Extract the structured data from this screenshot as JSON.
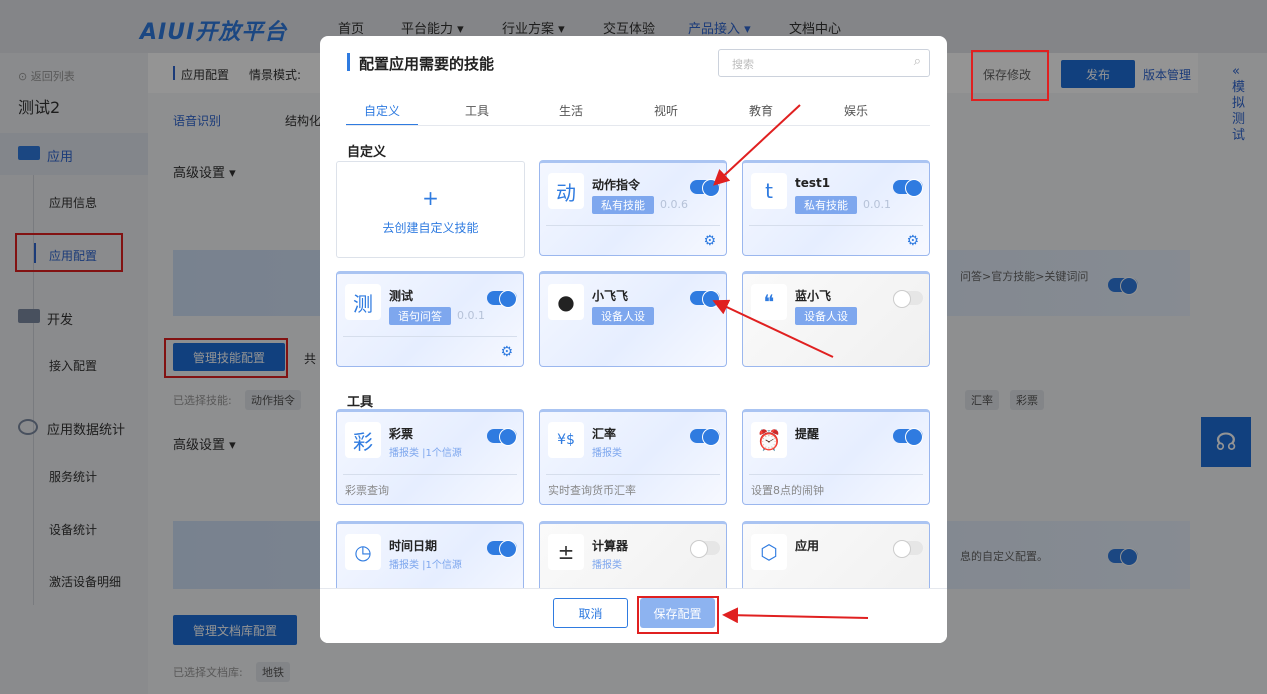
{
  "nav": {
    "logo_a": "AIUI",
    "logo_b": "开放平台",
    "items": [
      "首页",
      "平台能力 ▾",
      "行业方案 ▾",
      "交互体验",
      "产品接入 ▾",
      "文档中心"
    ]
  },
  "sidebar": {
    "back": "⊙ 返回列表",
    "app_name": "测试2",
    "section_app": "应用",
    "app_info": "应用信息",
    "app_config": "应用配置",
    "section_dev": "开发",
    "access_config": "接入配置",
    "section_stats": "应用数据统计",
    "service_stats": "服务统计",
    "device_stats": "设备统计",
    "activation_detail": "激活设备明细"
  },
  "main": {
    "breadcrumb": "应用配置",
    "scene_label": "情景模式:",
    "tab_asr": "语音识别",
    "tab_struct": "结构化",
    "adv1": "高级设置 ▾",
    "adv2": "高级设置 ▾",
    "manage_skill": "管理技能配置",
    "shared": "共",
    "selected_skills_label": "已选择技能:",
    "selected_skill_first": "动作指令",
    "selected_skill_r1": "汇率",
    "selected_skill_r2": "彩票",
    "banner1_text": "问答>官方技能>关键词问",
    "banner2_text": "息的自定义配置。",
    "manage_doc": "管理文档库配置",
    "selected_doc_label": "已选择文档库:",
    "selected_doc": "地铁",
    "save_changes": "保存修改",
    "publish": "发布",
    "version": "版本管理",
    "sim_test": "« 模 拟 测 试"
  },
  "modal": {
    "title": "配置应用需要的技能",
    "search_placeholder": "搜索",
    "tabs": [
      "自定义",
      "工具",
      "生活",
      "视听",
      "教育",
      "娱乐"
    ],
    "section_custom": "自定义",
    "create_plus": "+",
    "create_label": "去创建自定义技能",
    "section_tools": "工具",
    "cancel": "取消",
    "save": "保存配置",
    "custom_cards": [
      {
        "icon": "动",
        "name": "动作指令",
        "tag": "私有技能",
        "ver": "0.0.6",
        "on": true
      },
      {
        "icon": "t",
        "name": "test1",
        "tag": "私有技能",
        "ver": "0.0.1",
        "on": true
      },
      {
        "icon": "测",
        "name": "测试",
        "tag": "语句问答",
        "ver": "0.0.1",
        "on": true
      },
      {
        "icon": "●",
        "name": "小飞飞",
        "tag": "设备人设",
        "ver": "",
        "on": true
      },
      {
        "icon": "❝",
        "name": "蓝小飞",
        "tag": "设备人设",
        "ver": "",
        "on": false
      }
    ],
    "tool_cards": [
      {
        "icon": "彩",
        "name": "彩票",
        "sub": "播报类 |1个信源",
        "desc": "彩票查询",
        "on": true
      },
      {
        "icon": "¥$",
        "name": "汇率",
        "sub": "播报类",
        "desc": "实时查询货币汇率",
        "on": true
      },
      {
        "icon": "⏰",
        "name": "提醒",
        "sub": "",
        "desc": "设置8点的闹钟",
        "on": true
      },
      {
        "icon": "◷",
        "name": "时间日期",
        "sub": "播报类 |1个信源",
        "desc": "",
        "on": true
      },
      {
        "icon": "±",
        "name": "计算器",
        "sub": "播报类",
        "desc": "",
        "on": false
      },
      {
        "icon": "⬡",
        "name": "应用",
        "sub": "",
        "desc": "",
        "on": false
      }
    ]
  },
  "colors": {
    "accent": "#2f7be0",
    "annotation": "#e02020"
  }
}
